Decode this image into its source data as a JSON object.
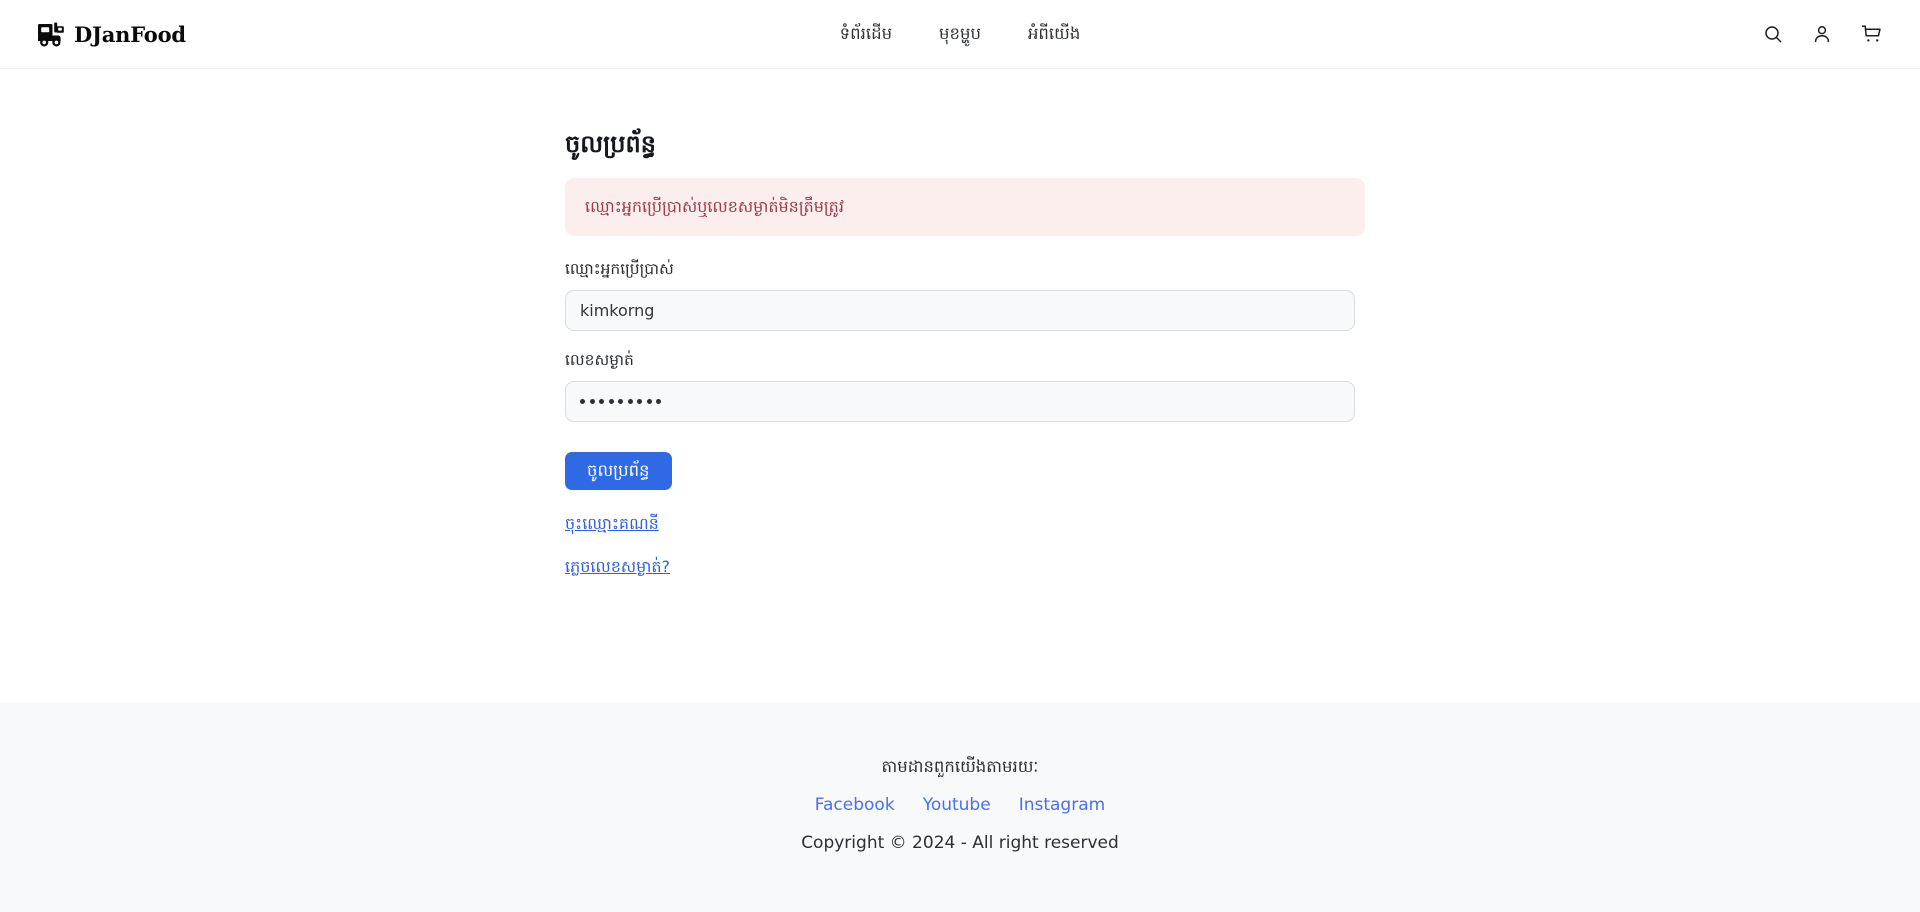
{
  "brand": {
    "name": "DJanFood",
    "icon": "delivery-truck-icon"
  },
  "header": {
    "nav": [
      {
        "label": "ទំព័រដើម",
        "name": "home"
      },
      {
        "label": "មុខម្ហូប",
        "name": "menu"
      },
      {
        "label": "អំពីយើង",
        "name": "about"
      }
    ],
    "actions": [
      {
        "icon": "search-icon"
      },
      {
        "icon": "user-account-icon"
      },
      {
        "icon": "shopping-cart-icon"
      }
    ]
  },
  "login": {
    "title": "ចូលប្រព័ន្ធ",
    "error": "ឈ្មោះអ្នកប្រើប្រាស់ឬលេខសម្ងាត់មិនត្រឹមត្រូវ",
    "username": {
      "label": "ឈ្មោះអ្នកប្រើប្រាស់",
      "value": "kimkorng",
      "placeholder": ""
    },
    "password": {
      "label": "លេខសម្ងាត់",
      "value": "·········",
      "masked_length": 9,
      "placeholder": ""
    },
    "submit_label": "ចូលប្រព័ន្ធ",
    "register_link": "ចុះឈ្មោះគណនី",
    "forgot_link": "ភ្លេចលេខសម្ងាត់?"
  },
  "footer": {
    "heading": "តាមដានពួកយើងតាមរយៈ",
    "socials": [
      {
        "label": "Facebook"
      },
      {
        "label": "Youtube"
      },
      {
        "label": "Instagram"
      }
    ],
    "copyright": "Copyright © 2024 - All right reserved"
  },
  "colors": {
    "primary": "#2f6ae4",
    "link": "#2f5fe0",
    "social_link": "#4a6ef0",
    "alert_bg": "#fdeeee",
    "alert_text": "#9b3b4a",
    "footer_bg": "#f8f9fb",
    "input_bg": "#f8f9fb",
    "input_border": "#d9dde3"
  }
}
